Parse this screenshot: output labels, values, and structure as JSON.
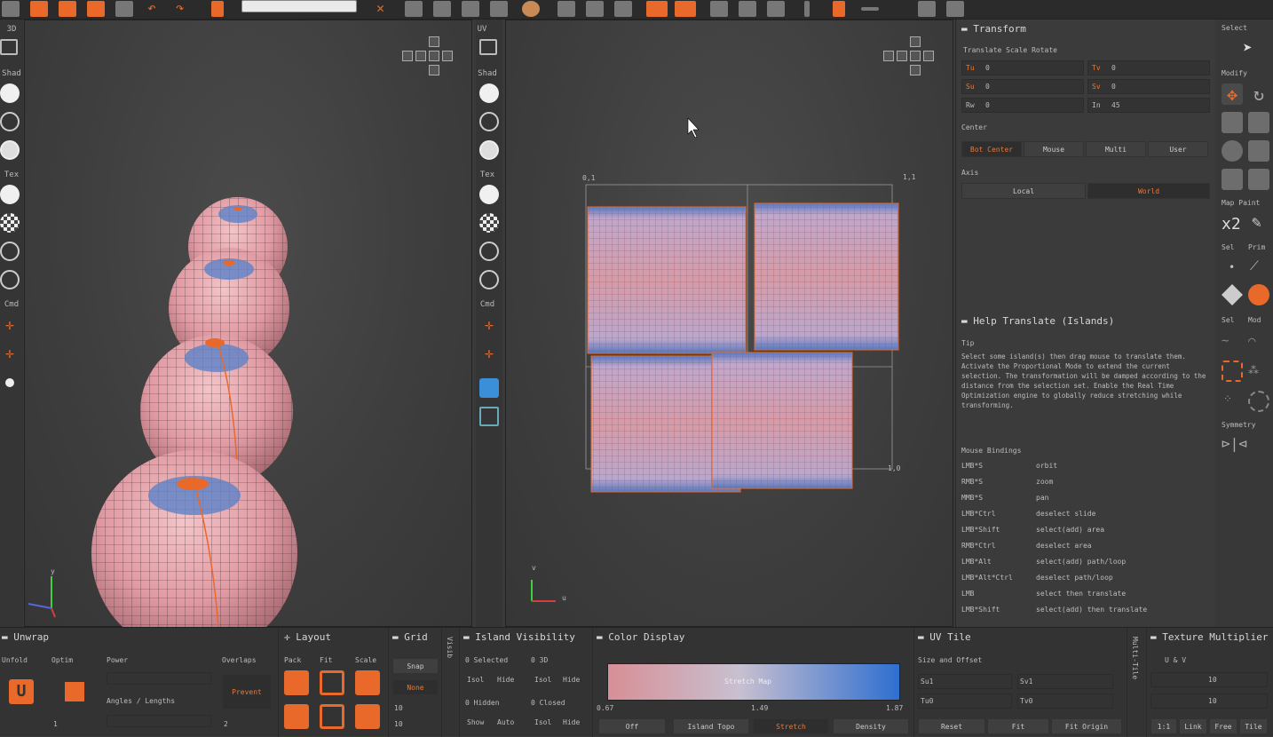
{
  "left_strip": {
    "mode_label": "3D",
    "shad_label": "Shad",
    "tex_label": "Tex",
    "cmd_label": "Cmd"
  },
  "mid_strip": {
    "mode_label": "UV",
    "shad_label": "Shad",
    "tex_label": "Tex",
    "cmd_label": "Cmd"
  },
  "viewport_3d": {
    "axis_y": "y"
  },
  "viewport_uv": {
    "corner_tl": "0,1",
    "corner_tr": "1,1",
    "corner_br": "1,0",
    "axis_y": "v",
    "axis_x": "u"
  },
  "transform": {
    "title": "Transform",
    "tabs": "Translate Scale Rotate",
    "fields": [
      {
        "label": "Tu",
        "value": "0"
      },
      {
        "label": "Tv",
        "value": "0"
      },
      {
        "label": "Su",
        "value": "0"
      },
      {
        "label": "Sv",
        "value": "0"
      },
      {
        "label": "Rw",
        "value": "0"
      },
      {
        "label": "In",
        "value": "45"
      }
    ],
    "center_label": "Center",
    "center_options": [
      "Bot Center",
      "Mouse",
      "Multi",
      "User"
    ],
    "axis_label": "Axis",
    "axis_options": [
      "Local",
      "World"
    ]
  },
  "help": {
    "title": "Help Translate (Islands)",
    "tip_label": "Tip",
    "tip_text": "Select some island(s) then drag mouse to translate them. Activate the Proportional Mode to extend the current selection. The transformation will be damped according to the distance from the selection set. Enable the Real Time Optimization engine to globally reduce stretching while transforming.",
    "bindings_label": "Mouse Bindings",
    "bindings": [
      {
        "key": "LMB*S",
        "action": "orbit"
      },
      {
        "key": "RMB*S",
        "action": "zoom"
      },
      {
        "key": "MMB*S",
        "action": "pan"
      },
      {
        "key": "LMB*Ctrl",
        "action": "deselect slide"
      },
      {
        "key": "LMB*Shift",
        "action": "select(add) area"
      },
      {
        "key": "RMB*Ctrl",
        "action": "deselect area"
      },
      {
        "key": "LMB*Alt",
        "action": "select(add) path/loop"
      },
      {
        "key": "LMB*Alt*Ctrl",
        "action": "deselect path/loop"
      },
      {
        "key": "LMB",
        "action": "select then translate"
      },
      {
        "key": "LMB*Shift",
        "action": "select(add) then translate"
      }
    ]
  },
  "right_tools": {
    "select": "Select",
    "modify": "Modify",
    "map_paint": "Map Paint",
    "x2": "x2",
    "sel": "Sel",
    "prim": "Prim",
    "sel2": "Sel",
    "mod": "Mod",
    "symmetry": "Symmetry"
  },
  "bottom": {
    "unwrap": {
      "title": "Unwrap",
      "col1": "Unfold",
      "col2": "Optim",
      "col3": "Power",
      "col4": "Overlaps",
      "angles": "Angles / Lengths",
      "overlap_btn": "Prevent",
      "optim_value": "1",
      "overlaps_value": "2"
    },
    "layout": {
      "title": "Layout",
      "cols": [
        "Pack",
        "Fit",
        "Scale"
      ]
    },
    "grid": {
      "title": "Grid",
      "snap": "Snap",
      "state": "None",
      "v1": "10",
      "v2": "10"
    },
    "visib": {
      "label": "Visib"
    },
    "island": {
      "title": "Island Visibility",
      "rows": [
        [
          "0 Selected",
          "0 3D"
        ],
        [
          "Isol",
          "Hide",
          "Isol",
          "Hide"
        ],
        [
          "0 Hidden",
          "0 Closed"
        ],
        [
          "Show",
          "Auto",
          "Isol",
          "Hide"
        ]
      ]
    },
    "color": {
      "title": "Color Display",
      "map_label": "Stretch Map",
      "min": "0.67",
      "mid": "1.49",
      "max": "1.87",
      "modes": [
        "Off",
        "Island Topo",
        "Stretch",
        "Density"
      ]
    },
    "uvtile": {
      "title": "UV Tile",
      "size": "Size and Offset",
      "su": "Su1",
      "sv": "Sv1",
      "tu": "Tu0",
      "tv": "Tv0",
      "buttons": [
        "Reset",
        "Fit",
        "Fit Origin"
      ]
    },
    "multitile": {
      "label": "Multi-Tile"
    },
    "texmult": {
      "title": "Texture Multiplier",
      "uv": "U & V",
      "v1": "10",
      "v2": "10",
      "buttons": [
        "1:1",
        "Link",
        "Free",
        "Tile"
      ]
    }
  }
}
